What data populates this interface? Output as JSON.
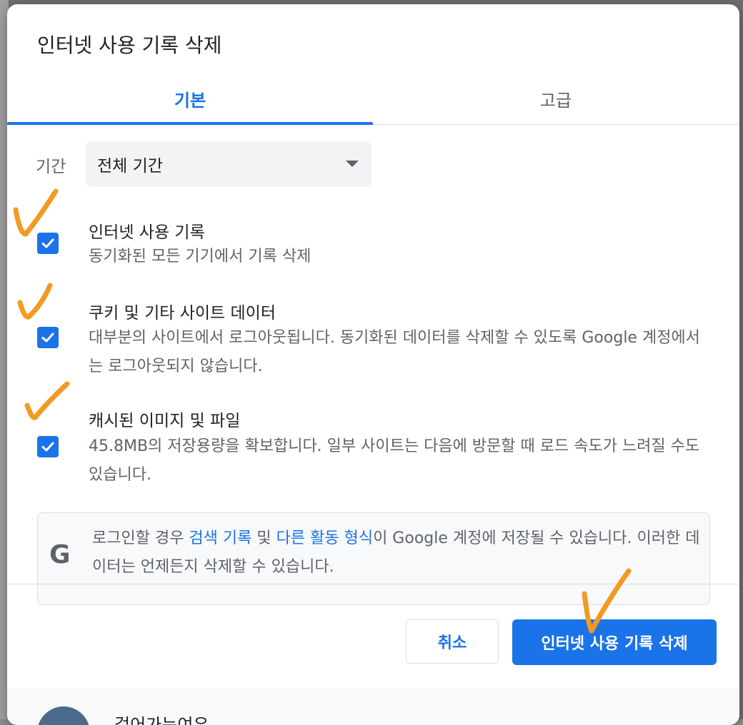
{
  "dialog": {
    "title": "인터넷 사용 기록 삭제",
    "tabs": [
      {
        "label": "기본",
        "active": true
      },
      {
        "label": "고급",
        "active": false
      }
    ],
    "period": {
      "label": "기간",
      "value": "전체 기간"
    },
    "options": [
      {
        "title": "인터넷 사용 기록",
        "desc": "동기화된 모든 기기에서 기록 삭제",
        "checked": true
      },
      {
        "title": "쿠키 및 기타 사이트 데이터",
        "desc": "대부분의 사이트에서 로그아웃됩니다. 동기화된 데이터를 삭제할 수 있도록 Google 계정에서는 로그아웃되지 않습니다.",
        "checked": true
      },
      {
        "title": "캐시된 이미지 및 파일",
        "desc": "45.8MB의 저장용량을 확보합니다. 일부 사이트는 다음에 방문할 때 로드 속도가 느려질 수도 있습니다.",
        "checked": true
      }
    ],
    "info": {
      "icon": "google-g-icon",
      "text_before": "로그인할 경우 ",
      "link1": "검색 기록",
      "text_mid": " 및 ",
      "link2": "다른 활동 형식",
      "text_after": "이 Google 계정에 저장될 수 있습니다. 이러한 데이터는 언제든지 삭제할 수 있습니다."
    },
    "buttons": {
      "cancel": "취소",
      "delete": "인터넷 사용 기록 삭제"
    },
    "profile": {
      "name": "걸어가는여우"
    }
  },
  "colors": {
    "accent": "#1a73e8",
    "annotation": "#f39a23"
  }
}
